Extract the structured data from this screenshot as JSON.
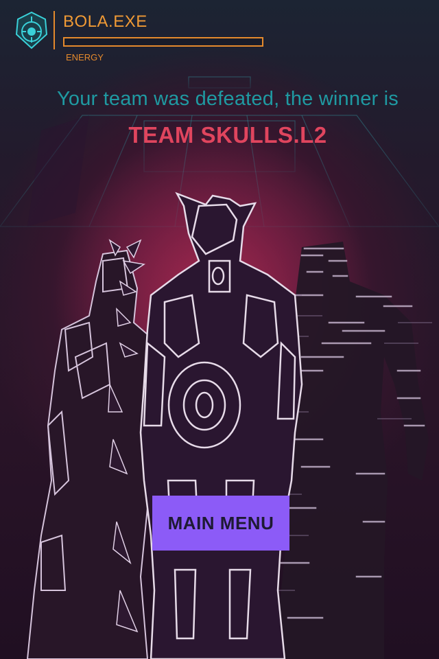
{
  "hud": {
    "player_name": "BOLA.EXE",
    "energy_label": "ENERGY",
    "energy_level": 0,
    "emblem_icon": "shield-emblem-icon",
    "accent_color": "#e58a2c"
  },
  "result": {
    "message": "Your team was defeated, the winner is",
    "winner": "TEAM SKULLS.L2",
    "message_color": "#1f9aa2",
    "winner_color": "#e0455e"
  },
  "actions": {
    "main_menu_label": "MAIN MENU",
    "button_color": "#8c5bf7"
  }
}
